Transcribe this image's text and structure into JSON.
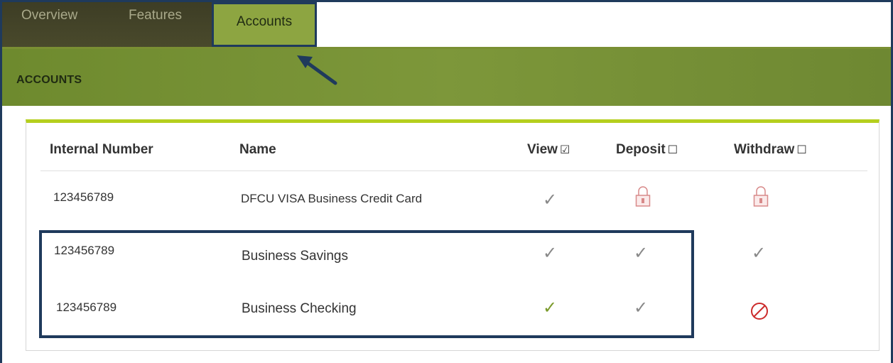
{
  "tabs": {
    "overview": "Overview",
    "features": "Features",
    "accounts": "Accounts"
  },
  "section": {
    "title": "ACCOUNTS"
  },
  "table": {
    "headers": {
      "internal_number": "Internal Number",
      "name": "Name",
      "view": "View",
      "view_box": "☑",
      "deposit": "Deposit",
      "deposit_box": "☐",
      "withdraw": "Withdraw",
      "withdraw_box": "☐"
    },
    "rows": [
      {
        "internal_number": "123456789",
        "name": "DFCU VISA Business Credit Card",
        "view": "check",
        "deposit": "lock-icon",
        "withdraw": "lock-icon"
      },
      {
        "internal_number": "123456789",
        "name": "Business Savings",
        "view": "check",
        "deposit": "check",
        "withdraw": "check"
      },
      {
        "internal_number": "123456789",
        "name": "Business Checking",
        "view": "check-green",
        "deposit": "check",
        "withdraw": "no-access-icon"
      }
    ],
    "check_glyph": "✓"
  },
  "colors": {
    "accent_green": "#8da541",
    "header_bar": "#7d973a",
    "highlight_border": "#1f3a5c",
    "lock_color": "#d88a8a",
    "deny_color": "#cc2b2b"
  }
}
